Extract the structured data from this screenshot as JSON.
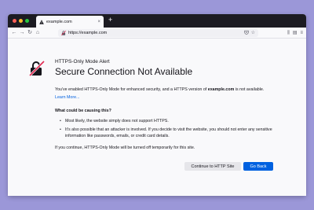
{
  "tab": {
    "title": "example.com",
    "close": "×",
    "new_tab": "+"
  },
  "toolbar": {
    "back": "←",
    "forward": "→",
    "reload": "↻",
    "home": "⌂",
    "url": "https://example.com",
    "bookmark_star": "☆",
    "library": "⫼",
    "sidebar": "▤",
    "menu": "≡"
  },
  "alert": {
    "subtitle": "HTTPS-Only Mode Alert",
    "title": "Secure Connection Not Available",
    "intro_before": "You've enabled HTTPS-Only Mode for enhanced security, and a HTTPS version of ",
    "intro_domain": "example.com",
    "intro_after": " is not available.",
    "learn_more": "Learn More...",
    "causes_heading": "What could be causing this?",
    "causes": [
      "Most likely, the website simply does not support HTTPS.",
      "It's also possible that an attacker is involved. If you decide to visit the website, you should not enter any sensitive information like passwords, emails, or credit card details."
    ],
    "footer": "If you continue, HTTPS-Only Mode will be turned off temporarily for this site.",
    "continue_button": "Continue to HTTP Site",
    "back_button": "Go Back"
  },
  "colors": {
    "background": "#9b97d8",
    "tabbar": "#1c1b22",
    "primary": "#0061e0",
    "link": "#0060df",
    "alert_icon": "#e22850"
  }
}
